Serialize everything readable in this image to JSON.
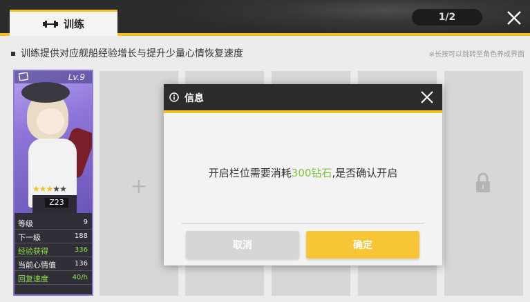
{
  "header": {
    "tab_label": "训练",
    "page_indicator": "1/2"
  },
  "description": {
    "text": "训练提供对应舰船经验增长与提升少量心情恢复速度",
    "hint": "※长按可以跳转至角色养成界面"
  },
  "ship_card": {
    "level": "Lv.9",
    "name": "Z23",
    "stars_filled": 3,
    "stars_total": 5,
    "stats": [
      {
        "label": "等级",
        "value": "9",
        "highlight": false
      },
      {
        "label": "下一级",
        "value": "188",
        "highlight": false
      },
      {
        "label": "经验获得",
        "value": "336",
        "highlight": true
      },
      {
        "label": "当前心情值",
        "value": "136",
        "highlight": false
      },
      {
        "label": "回复速度",
        "value": "40/h",
        "highlight": true
      }
    ]
  },
  "slots": {
    "add_symbol": "+"
  },
  "dialog": {
    "title": "信息",
    "message_prefix": "开启栏位需要消耗",
    "message_highlight": "300钻石",
    "message_suffix": ",是否确认开启",
    "cancel_label": "取消",
    "confirm_label": "确定"
  },
  "colors": {
    "accent_yellow": "#f5c020",
    "highlight_green": "#7cc43a",
    "header_dark": "#2c2c2c",
    "card_border": "#8f7ad8"
  },
  "icons": {
    "tab_icon": "dumbbell-icon",
    "close": "close-icon",
    "info": "info-icon",
    "lock": "lock-icon"
  }
}
